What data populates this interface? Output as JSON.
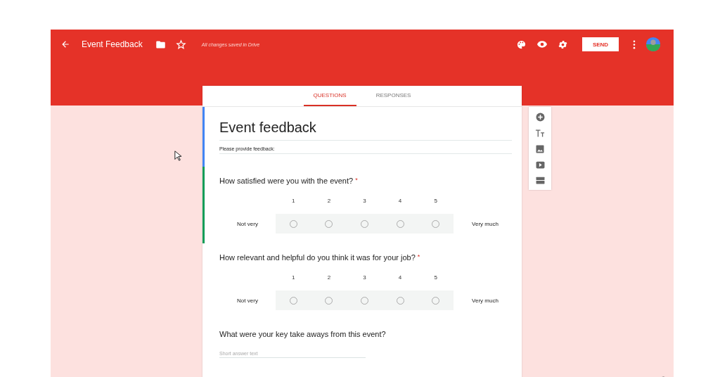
{
  "header": {
    "title": "Event Feedback",
    "save_status": "All changes saved in Drive",
    "send_button": "SEND"
  },
  "tabs": [
    {
      "label": "QUESTIONS",
      "selected": true
    },
    {
      "label": "RESPONSES",
      "selected": false
    }
  ],
  "form": {
    "title": "Event feedback",
    "description": "Please provide feedback:"
  },
  "questions": [
    {
      "kind": "scale",
      "text": "How satisfied were you with the event?",
      "required_mark": "*",
      "selected": true,
      "low_label": "Not very",
      "high_label": "Very much",
      "options": [
        {
          "label": "1",
          "checked": false
        },
        {
          "label": "2",
          "checked": false
        },
        {
          "label": "3",
          "checked": false
        },
        {
          "label": "4",
          "checked": false
        },
        {
          "label": "5",
          "checked": false
        }
      ]
    },
    {
      "kind": "scale",
      "text": "How relevant and helpful do you think it was for your job?",
      "required_mark": "*",
      "selected": false,
      "low_label": "Not very",
      "high_label": "Very much",
      "options": [
        {
          "label": "1",
          "checked": false
        },
        {
          "label": "2",
          "checked": false
        },
        {
          "label": "3",
          "checked": false
        },
        {
          "label": "4",
          "checked": false
        },
        {
          "label": "5",
          "checked": false
        }
      ]
    },
    {
      "kind": "short",
      "text": "What were your key take aways from this event?",
      "selected": false,
      "placeholder": "Short answer text"
    }
  ]
}
